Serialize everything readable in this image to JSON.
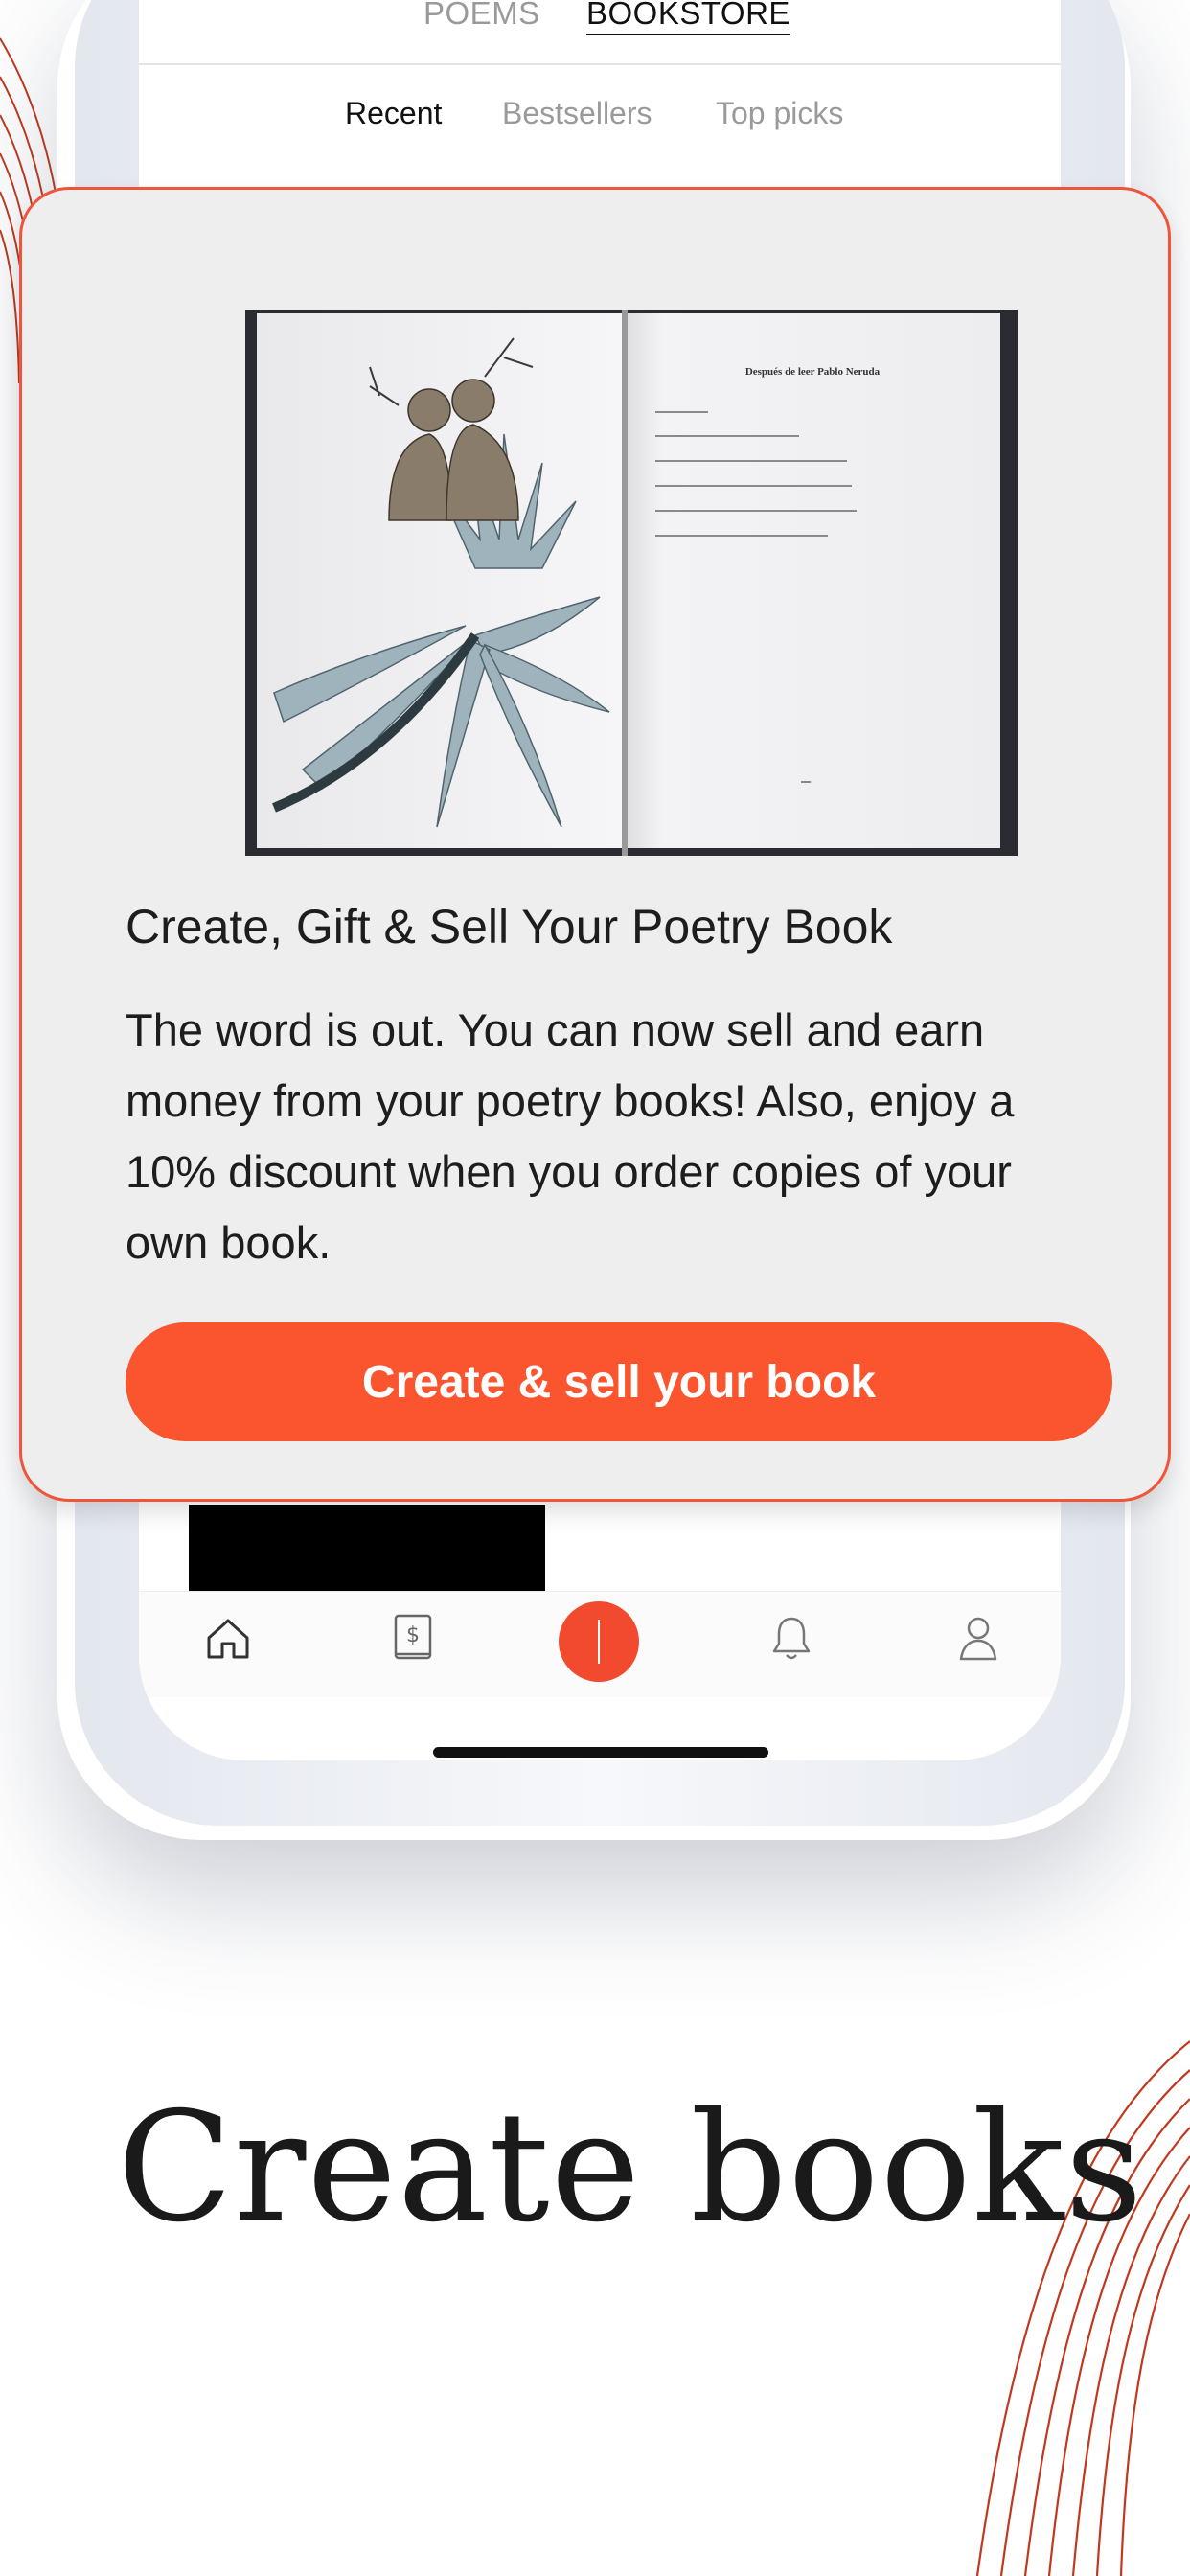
{
  "app": {
    "top_tabs": [
      {
        "label": "POEMS",
        "active": false
      },
      {
        "label": "BOOKSTORE",
        "active": true
      }
    ],
    "sub_tabs": [
      {
        "label": "Recent",
        "active": true
      },
      {
        "label": "Bestsellers",
        "active": false
      },
      {
        "label": "Top picks",
        "active": false
      }
    ],
    "tab_bar": {
      "icons": [
        "home-icon",
        "dollar-book-icon",
        "compose-icon",
        "bell-icon",
        "profile-icon"
      ],
      "active_color": "#f24a2f"
    }
  },
  "promo_card": {
    "image_semantic": "open-poetry-book-photo",
    "book_page_heading": "Después de leer Pablo Neruda",
    "title": "Create, Gift & Sell Your Poetry Book",
    "body": "The word is out. You can now sell and earn money from your poetry books!  Also, enjoy a 10% discount when you order copies of your own book.",
    "button_label": "Create & sell your book",
    "border_color": "#ef553a",
    "button_color": "#fb5530"
  },
  "headline": "Create books",
  "decor_color": "#c0391e"
}
